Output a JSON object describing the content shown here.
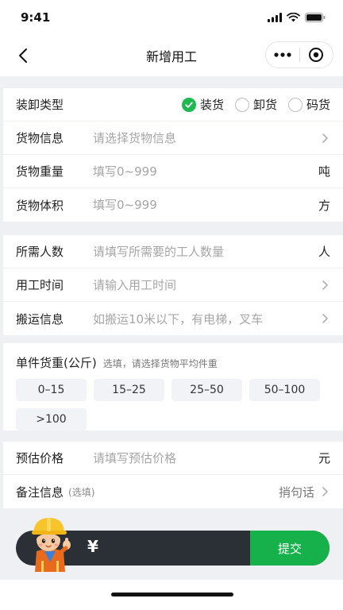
{
  "status": {
    "time": "9:41"
  },
  "nav": {
    "title": "新增用工"
  },
  "load_type": {
    "label": "装卸类型",
    "options": [
      {
        "label": "装货",
        "checked": true
      },
      {
        "label": "卸货",
        "checked": false
      },
      {
        "label": "码货",
        "checked": false
      }
    ]
  },
  "goods": {
    "info": {
      "label": "货物信息",
      "placeholder": "请选择货物信息"
    },
    "weight": {
      "label": "货物重量",
      "placeholder": "填写0~999",
      "unit": "吨"
    },
    "volume": {
      "label": "货物体积",
      "placeholder": "填写0~999",
      "unit": "方"
    }
  },
  "work": {
    "people": {
      "label": "所需人数",
      "placeholder": "请填写所需要的工人数量",
      "unit": "人"
    },
    "time": {
      "label": "用工时间",
      "placeholder": "请输入用工时间"
    },
    "transport": {
      "label": "搬运信息",
      "placeholder": "如搬运10米以下，有电梯，叉车"
    }
  },
  "unit_weight": {
    "label": "单件货重(公斤)",
    "hint": "选填，请选择货物平均件重",
    "options": [
      "0–15",
      "15–25",
      "25–50",
      "50–100",
      ">100"
    ]
  },
  "price": {
    "label": "预估价格",
    "placeholder": "请填写预估价格",
    "unit": "元"
  },
  "remark": {
    "label": "备注信息",
    "optional": "(选填)",
    "action": "捎句话"
  },
  "bottom": {
    "currency": "¥",
    "submit": "提交"
  },
  "colors": {
    "accent": "#1fb950",
    "submit": "#16b14b",
    "bar": "#2b2f36"
  }
}
